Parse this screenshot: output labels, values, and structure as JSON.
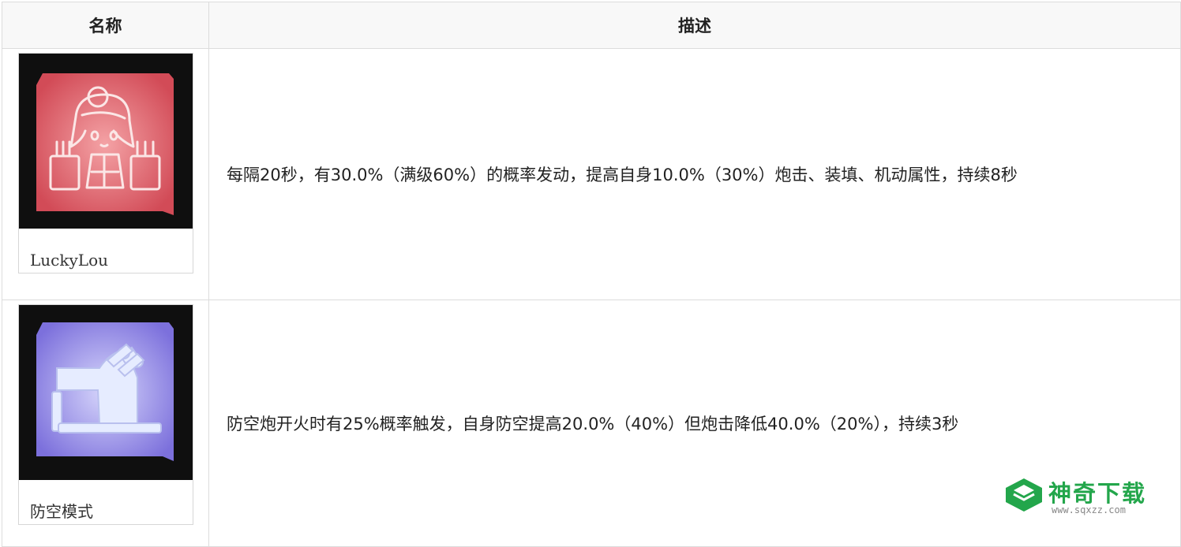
{
  "table": {
    "headers": {
      "name": "名称",
      "description": "描述"
    },
    "rows": [
      {
        "name": "LuckyLou",
        "icon": "lucky-lou-chibi-icon",
        "description": "每隔20秒，有30.0%（满级60%）的概率发动，提高自身10.0%（30%）炮击、装填、机动属性，持续8秒"
      },
      {
        "name": "防空模式",
        "icon": "anti-air-gun-icon",
        "description": "防空炮开火时有25%概率触发，自身防空提高20.0%（40%）但炮击降低40.0%（20%），持续3秒"
      }
    ]
  },
  "watermark": {
    "title": "神奇下载",
    "url": "www.sqxzz.com"
  },
  "colors": {
    "header_bg": "#f8f8f8",
    "border": "#dcdcdc",
    "lucky_card": "#d9545f",
    "aa_card": "#8a80e0",
    "watermark_green": "#23a64b"
  }
}
